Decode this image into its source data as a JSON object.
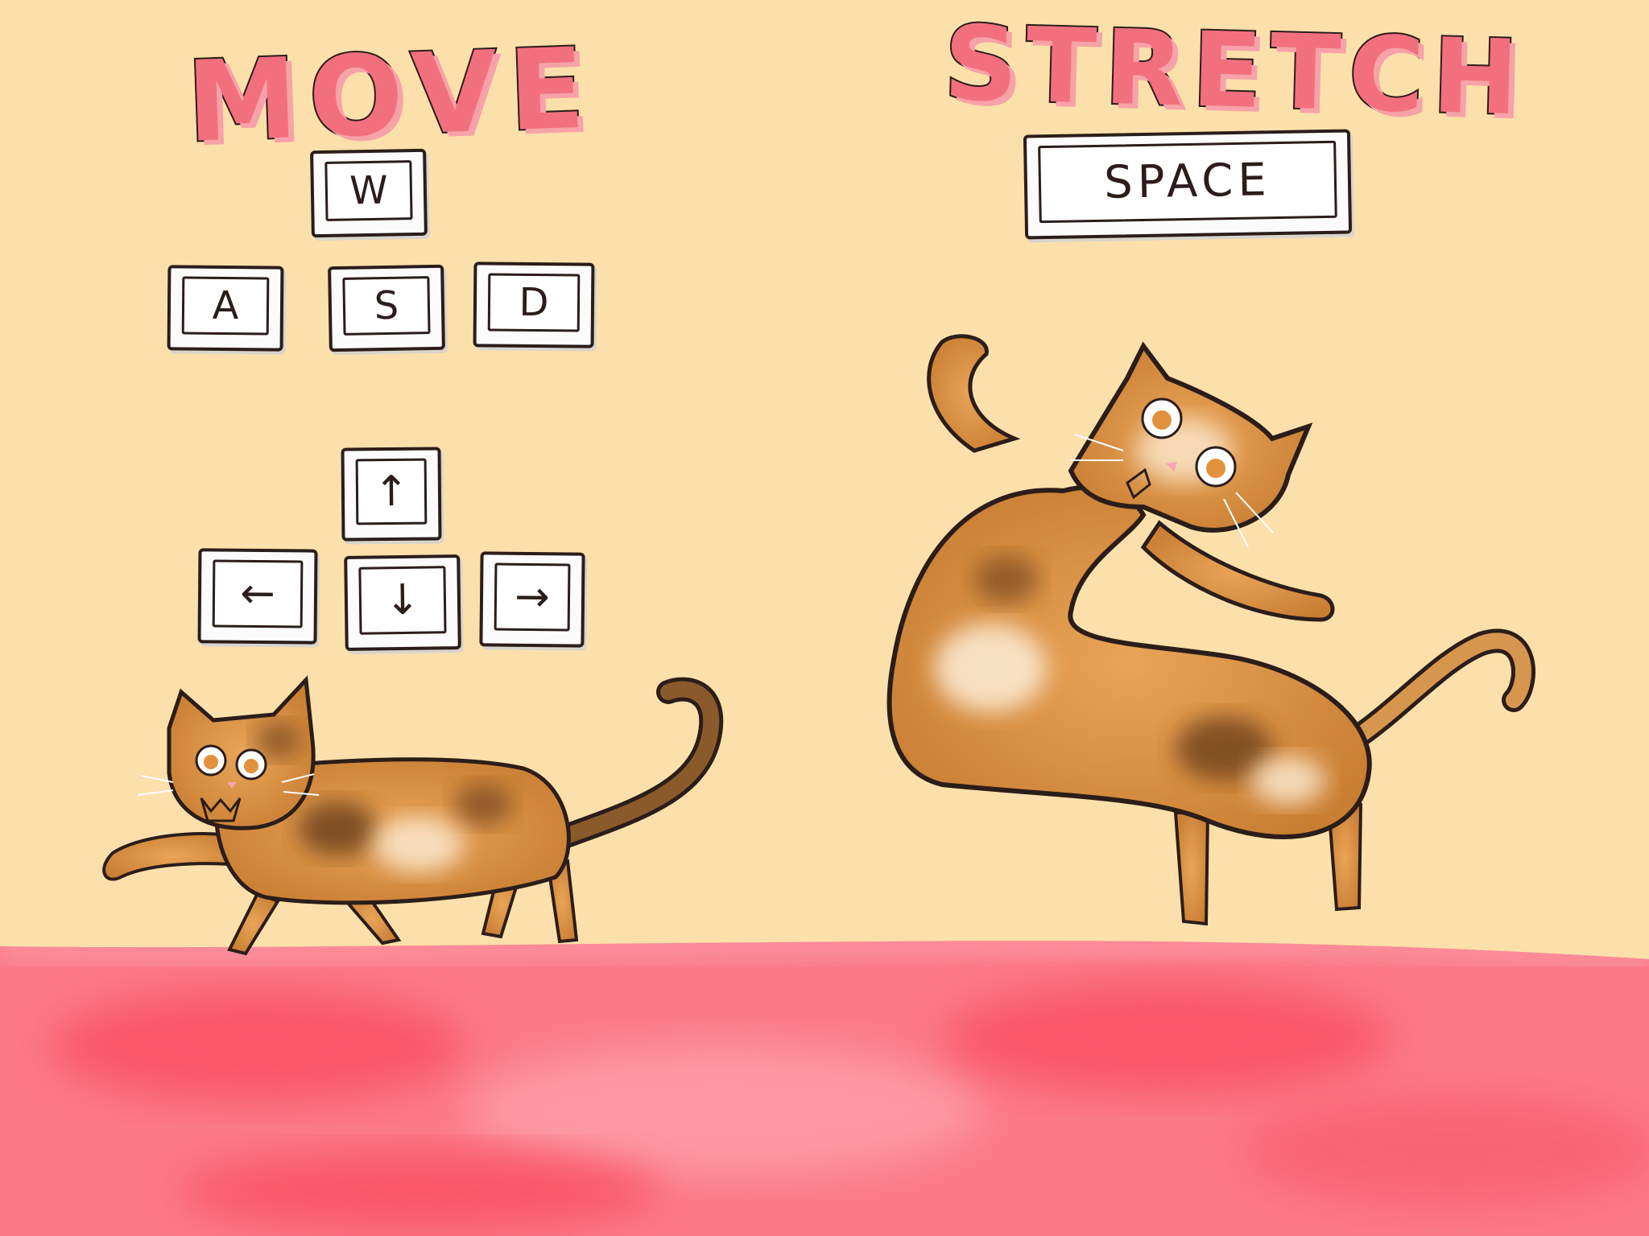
{
  "colors": {
    "background": "#fce0ab",
    "floor": "#f96b7b",
    "title_fill": "#f2707e",
    "ink": "#2b1d1a",
    "cat_base": "#d98e3b",
    "cat_dark": "#6e3e1a",
    "cat_light": "#fbe8cf",
    "key_face": "#ffffff"
  },
  "move": {
    "title": "MOVE",
    "wasd_keys": [
      "W",
      "A",
      "S",
      "D"
    ],
    "arrow_keys": [
      {
        "label": "↑",
        "icon": "arrow-up-icon"
      },
      {
        "label": "←",
        "icon": "arrow-left-icon"
      },
      {
        "label": "↓",
        "icon": "arrow-down-icon"
      },
      {
        "label": "→",
        "icon": "arrow-right-icon"
      }
    ]
  },
  "stretch": {
    "title": "STRETCH",
    "key": "SPACE"
  },
  "illustrations": {
    "walking_cat": "calico-cat-walking-icon",
    "stretching_cat": "calico-cat-stretching-icon",
    "floor": "pink-watercolor-floor"
  }
}
